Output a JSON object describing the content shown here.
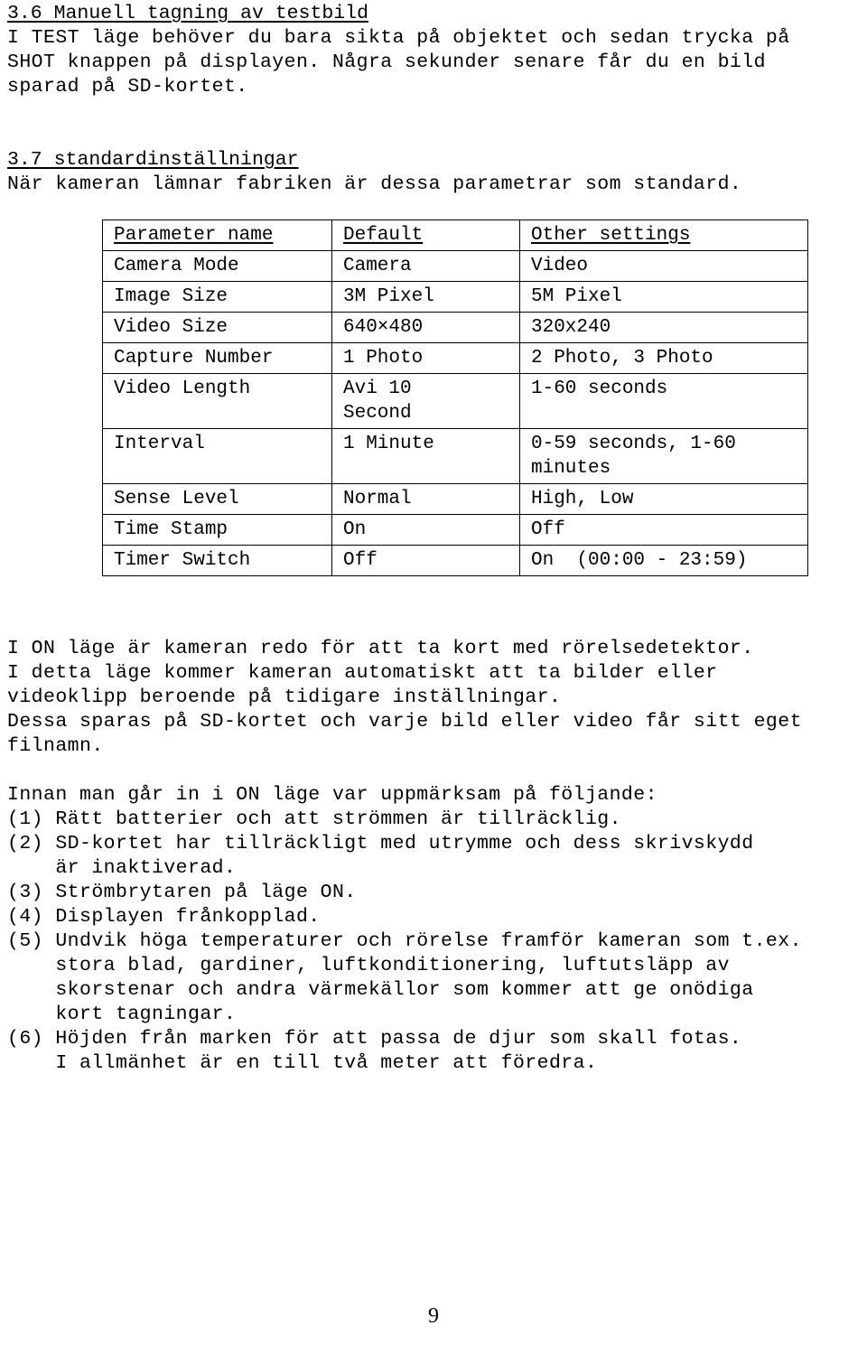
{
  "document": {
    "page_number": "9"
  },
  "section_36": {
    "heading": "3.6 Manuell tagning av testbild",
    "paragraph": [
      "I TEST läge behöver du bara sikta på objektet och sedan trycka på",
      "SHOT knappen på displayen. Några sekunder senare får du en bild",
      "sparad på SD-kortet."
    ]
  },
  "section_37": {
    "heading": "3.7 standardinställningar",
    "intro": "När kameran lämnar fabriken är dessa parametrar som standard.",
    "table": {
      "headers": [
        "Parameter name",
        "Default",
        "Other settings"
      ],
      "rows": [
        {
          "parameter": "Camera Mode",
          "default": "Camera",
          "other": "Video"
        },
        {
          "parameter": "Image Size",
          "default": "3M Pixel",
          "other": "5M Pixel"
        },
        {
          "parameter": "Video Size",
          "default": "640×480",
          "other": "320x240"
        },
        {
          "parameter": "Capture Number",
          "default": "1 Photo",
          "other": "2 Photo, 3 Photo"
        },
        {
          "parameter": "Video Length",
          "default": "Avi 10\nSecond",
          "other": "1-60 seconds"
        },
        {
          "parameter": "Interval",
          "default": "1 Minute",
          "other": "0-59 seconds, 1-60\nminutes"
        },
        {
          "parameter": "Sense Level",
          "default": "Normal",
          "other": "High, Low"
        },
        {
          "parameter": "Time Stamp",
          "default": "On",
          "other": "Off"
        },
        {
          "parameter": "Timer Switch",
          "default": "Off",
          "other": "On  (00:00 - 23:59)"
        }
      ]
    }
  },
  "on_mode": {
    "paragraph": [
      "I ON läge är kameran redo för att ta kort med rörelsedetektor.",
      "I detta läge kommer kameran automatiskt att ta bilder eller",
      "videoklipp beroende på tidigare inställningar.",
      "Dessa sparas på SD-kortet och varje bild eller video får sitt eget",
      "filnamn."
    ]
  },
  "checklist": {
    "intro": "Innan man går in i ON läge var uppmärksam på följande:",
    "items": [
      "(1) Rätt batterier och att strömmen är tillräcklig.",
      "(2) SD-kortet har tillräckligt med utrymme och dess skrivskydd",
      "    är inaktiverad.",
      "(3) Strömbrytaren på läge ON.",
      "(4) Displayen frånkopplad.",
      "(5) Undvik höga temperaturer och rörelse framför kameran som t.ex.",
      "    stora blad, gardiner, luftkonditionering, luftutsläpp av",
      "    skorstenar och andra värmekällor som kommer att ge onödiga",
      "    kort tagningar.",
      "(6) Höjden från marken för att passa de djur som skall fotas.",
      "    I allmänhet är en till två meter att föredra."
    ]
  }
}
